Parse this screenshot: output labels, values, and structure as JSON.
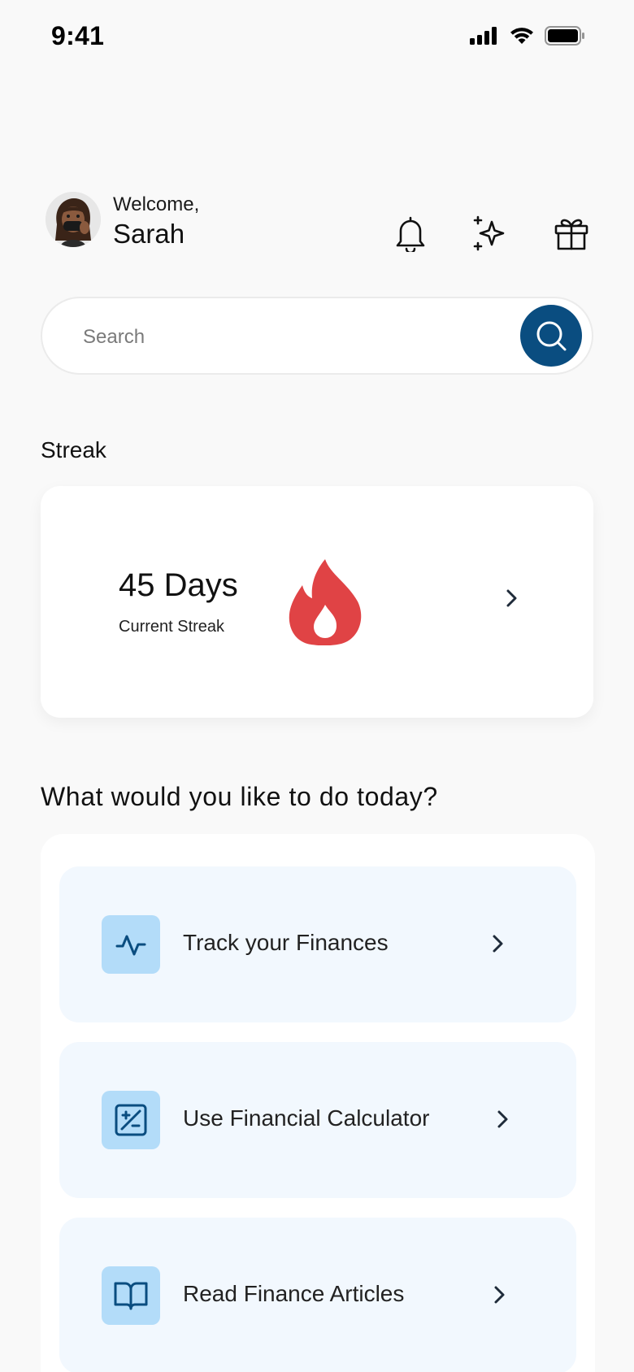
{
  "status_bar": {
    "time": "9:41",
    "icons": [
      "cellular-signal-icon",
      "wifi-icon",
      "battery-icon"
    ]
  },
  "header": {
    "welcome": "Welcome,",
    "name": "Sarah",
    "icons": [
      "bell-icon",
      "sparkles-icon",
      "gift-icon"
    ]
  },
  "search": {
    "placeholder": "Search",
    "value": ""
  },
  "streak": {
    "section_label": "Streak",
    "value": "45 Days",
    "caption": "Current Streak"
  },
  "actions": {
    "title": "What would you like to do today?",
    "items": [
      {
        "label": "Track your Finances",
        "icon": "activity-pulse-icon"
      },
      {
        "label": "Use Financial Calculator",
        "icon": "calculator-icon"
      },
      {
        "label": "Read Finance Articles",
        "icon": "open-book-icon"
      }
    ]
  },
  "colors": {
    "background": "#f9f9f9",
    "accent": "#0a4d80",
    "flame": "#e04345",
    "action_bg": "#f2f8fe",
    "icon_tile": "#b3dcf9",
    "icon_stroke": "#0a4d80"
  }
}
